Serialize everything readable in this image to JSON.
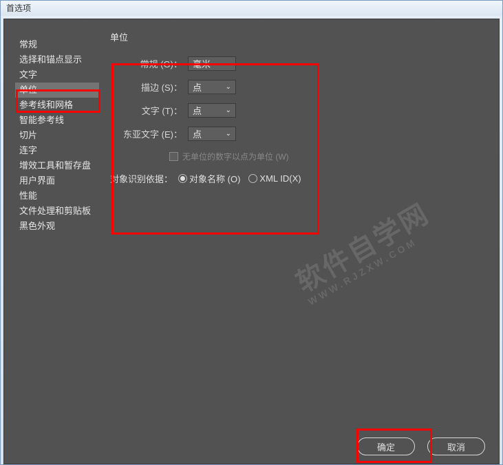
{
  "title": "首选项",
  "sidebar": {
    "items": [
      {
        "label": "常规"
      },
      {
        "label": "选择和锚点显示"
      },
      {
        "label": "文字"
      },
      {
        "label": "单位"
      },
      {
        "label": "参考线和网格"
      },
      {
        "label": "智能参考线"
      },
      {
        "label": "切片"
      },
      {
        "label": "连字"
      },
      {
        "label": "增效工具和暂存盘"
      },
      {
        "label": "用户界面"
      },
      {
        "label": "性能"
      },
      {
        "label": "文件处理和剪贴板"
      },
      {
        "label": "黑色外观"
      }
    ],
    "selected_index": 3
  },
  "content": {
    "section_title": "单位",
    "fields": {
      "general": {
        "label": "常规 (G)：",
        "value": "毫米"
      },
      "stroke": {
        "label": "描边 (S)：",
        "value": "点"
      },
      "text": {
        "label": "文字 (T)：",
        "value": "点"
      },
      "asian": {
        "label": "东亚文字 (E)：",
        "value": "点"
      }
    },
    "checkbox": {
      "label": "无单位的数字以点为单位 (W)"
    },
    "radio": {
      "main_label": "对象识别依据：",
      "options": [
        {
          "label": "对象名称 (O)",
          "checked": true
        },
        {
          "label": "XML ID(X)",
          "checked": false
        }
      ]
    }
  },
  "buttons": {
    "ok": "确定",
    "cancel": "取消"
  },
  "watermark": {
    "main": "软件自学网",
    "sub": "WWW.RJZXW.COM"
  }
}
